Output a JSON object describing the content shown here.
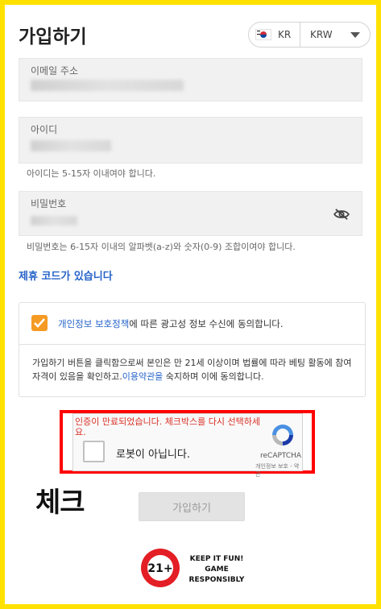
{
  "header": {
    "title": "가입하기"
  },
  "locale": {
    "lang_icon": "korea-flag-icon",
    "lang_code": "KR",
    "currency": "KRW"
  },
  "fields": {
    "email": {
      "label": "이메일 주소",
      "value": ""
    },
    "username": {
      "label": "아이디",
      "value": "",
      "hint": "아이디는 5-15자 이내여야 합니다."
    },
    "password": {
      "label": "비밀번호",
      "value": "",
      "hint": "비밀번호는 6-15자 이내의 알파벳(a-z)와 숫자(0-9) 조합이여야 합니다."
    }
  },
  "partner_code": {
    "label": "제휴 코드가 있습니다"
  },
  "consent": {
    "checked": true,
    "privacy_link": "개인정보 보호정책",
    "text_after": "에 따른 광고성 정보 수신에 동의합니다.",
    "notice_before": "가입하기 버튼을 클릭함으로써 본인은 만 21세 이상이며 법률에 따라 베팅 활동에 참여 자격이 있음을 확인하고.",
    "terms_link": "이용약관을",
    "notice_after": " 숙지하며 이에 동의합니다."
  },
  "recaptcha": {
    "error": "인증이 만료되었습니다. 체크박스를 다시 선택하세요.",
    "label": "로봇이 아닙니다.",
    "brand": "reCAPTCHA",
    "links": "개인정보 보호 - 약관"
  },
  "annotation": {
    "text": "체크",
    "color": "#ff0000"
  },
  "submit": {
    "label": "가입하기"
  },
  "responsible": {
    "badge": "21+",
    "slogan": [
      "KEEP IT FUN!",
      "GAME",
      "RESPONSIBLY"
    ]
  },
  "colors": {
    "page_border": "#ffe100",
    "accent_orange": "#f59a23",
    "link_blue": "#2563c9"
  }
}
